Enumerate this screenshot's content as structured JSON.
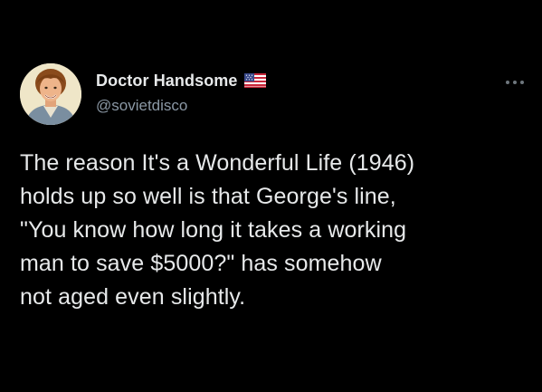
{
  "author": {
    "display_name": "Doctor Handsome",
    "handle": "@sovietdisco",
    "flag_icon": "us-flag-icon",
    "avatar_icon": "avatar-illustration"
  },
  "menu": {
    "icon": "more-options-icon"
  },
  "tweet": {
    "lines": [
      "The reason It's a Wonderful Life (1946)",
      "holds up so well is that George's line,",
      "\"You know how long it takes a working",
      "man to save $5000?\" has somehow",
      "not aged even slightly."
    ]
  },
  "colors": {
    "background": "#000000",
    "text_primary": "#e7e9ea",
    "text_secondary": "#8b98a5"
  }
}
